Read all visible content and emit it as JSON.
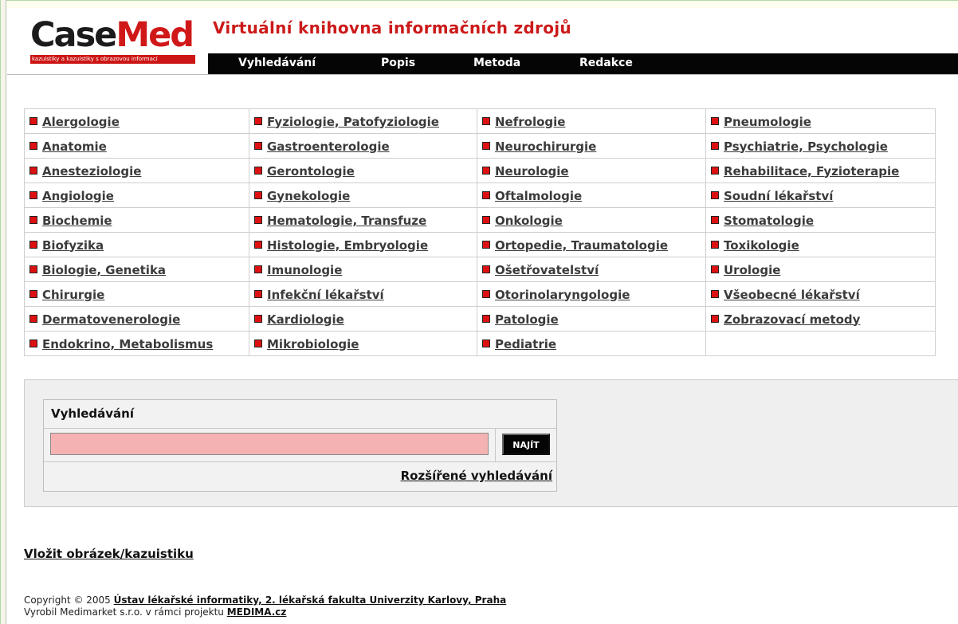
{
  "logo": {
    "word_part1": "Case",
    "word_part2": "Med",
    "tagline": "kazuistiky a kazuistiky s obrazovou informací"
  },
  "site_title": "Virtuální knihovna informačních zdrojů",
  "nav": [
    "Vyhledávání",
    "Popis",
    "Metoda",
    "Redakce"
  ],
  "categories": {
    "col1": [
      "Alergologie",
      "Anatomie",
      "Anesteziologie",
      "Angiologie",
      "Biochemie",
      "Biofyzika",
      "Biologie, Genetika",
      "Chirurgie",
      "Dermatovenerologie",
      "Endokrino, Metabolismus"
    ],
    "col2": [
      "Fyziologie, Patofyziologie",
      "Gastroenterologie",
      "Gerontologie",
      "Gynekologie",
      "Hematologie, Transfuze",
      "Histologie, Embryologie",
      "Imunologie",
      "Infekční lékařství",
      "Kardiologie",
      "Mikrobiologie"
    ],
    "col3": [
      "Nefrologie",
      "Neurochirurgie",
      "Neurologie",
      "Oftalmologie",
      "Onkologie",
      "Ortopedie, Traumatologie",
      "Ošetřovatelství",
      "Otorinolaryngologie",
      "Patologie",
      "Pediatrie"
    ],
    "col4": [
      "Pneumologie",
      "Psychiatrie, Psychologie",
      "Rehabilitace, Fyzioterapie",
      "Soudní lékařství",
      "Stomatologie",
      "Toxikologie",
      "Urologie",
      "Všeobecné lékařství",
      "Zobrazovací metody"
    ]
  },
  "search": {
    "title": "Vyhledávání",
    "input_value": "",
    "button_label": "NAJÍT",
    "advanced_link": "Rozšířené vyhledávání"
  },
  "insert_link": "Vložit obrázek/kazuistiku",
  "footer": {
    "copyright_prefix": "Copyright © 2005",
    "institution": "Ústav lékařské informatiky, 2. lékařská fakulta Univerzity Karlovy, Praha",
    "produced_prefix": "Vyrobil Medimarket s.r.o. v rámci projektu",
    "project_link": "MEDIMA.cz"
  },
  "colors": {
    "brand_red": "#cc1a1a",
    "nav_black": "#050505",
    "input_pink": "#f4b2b2"
  }
}
